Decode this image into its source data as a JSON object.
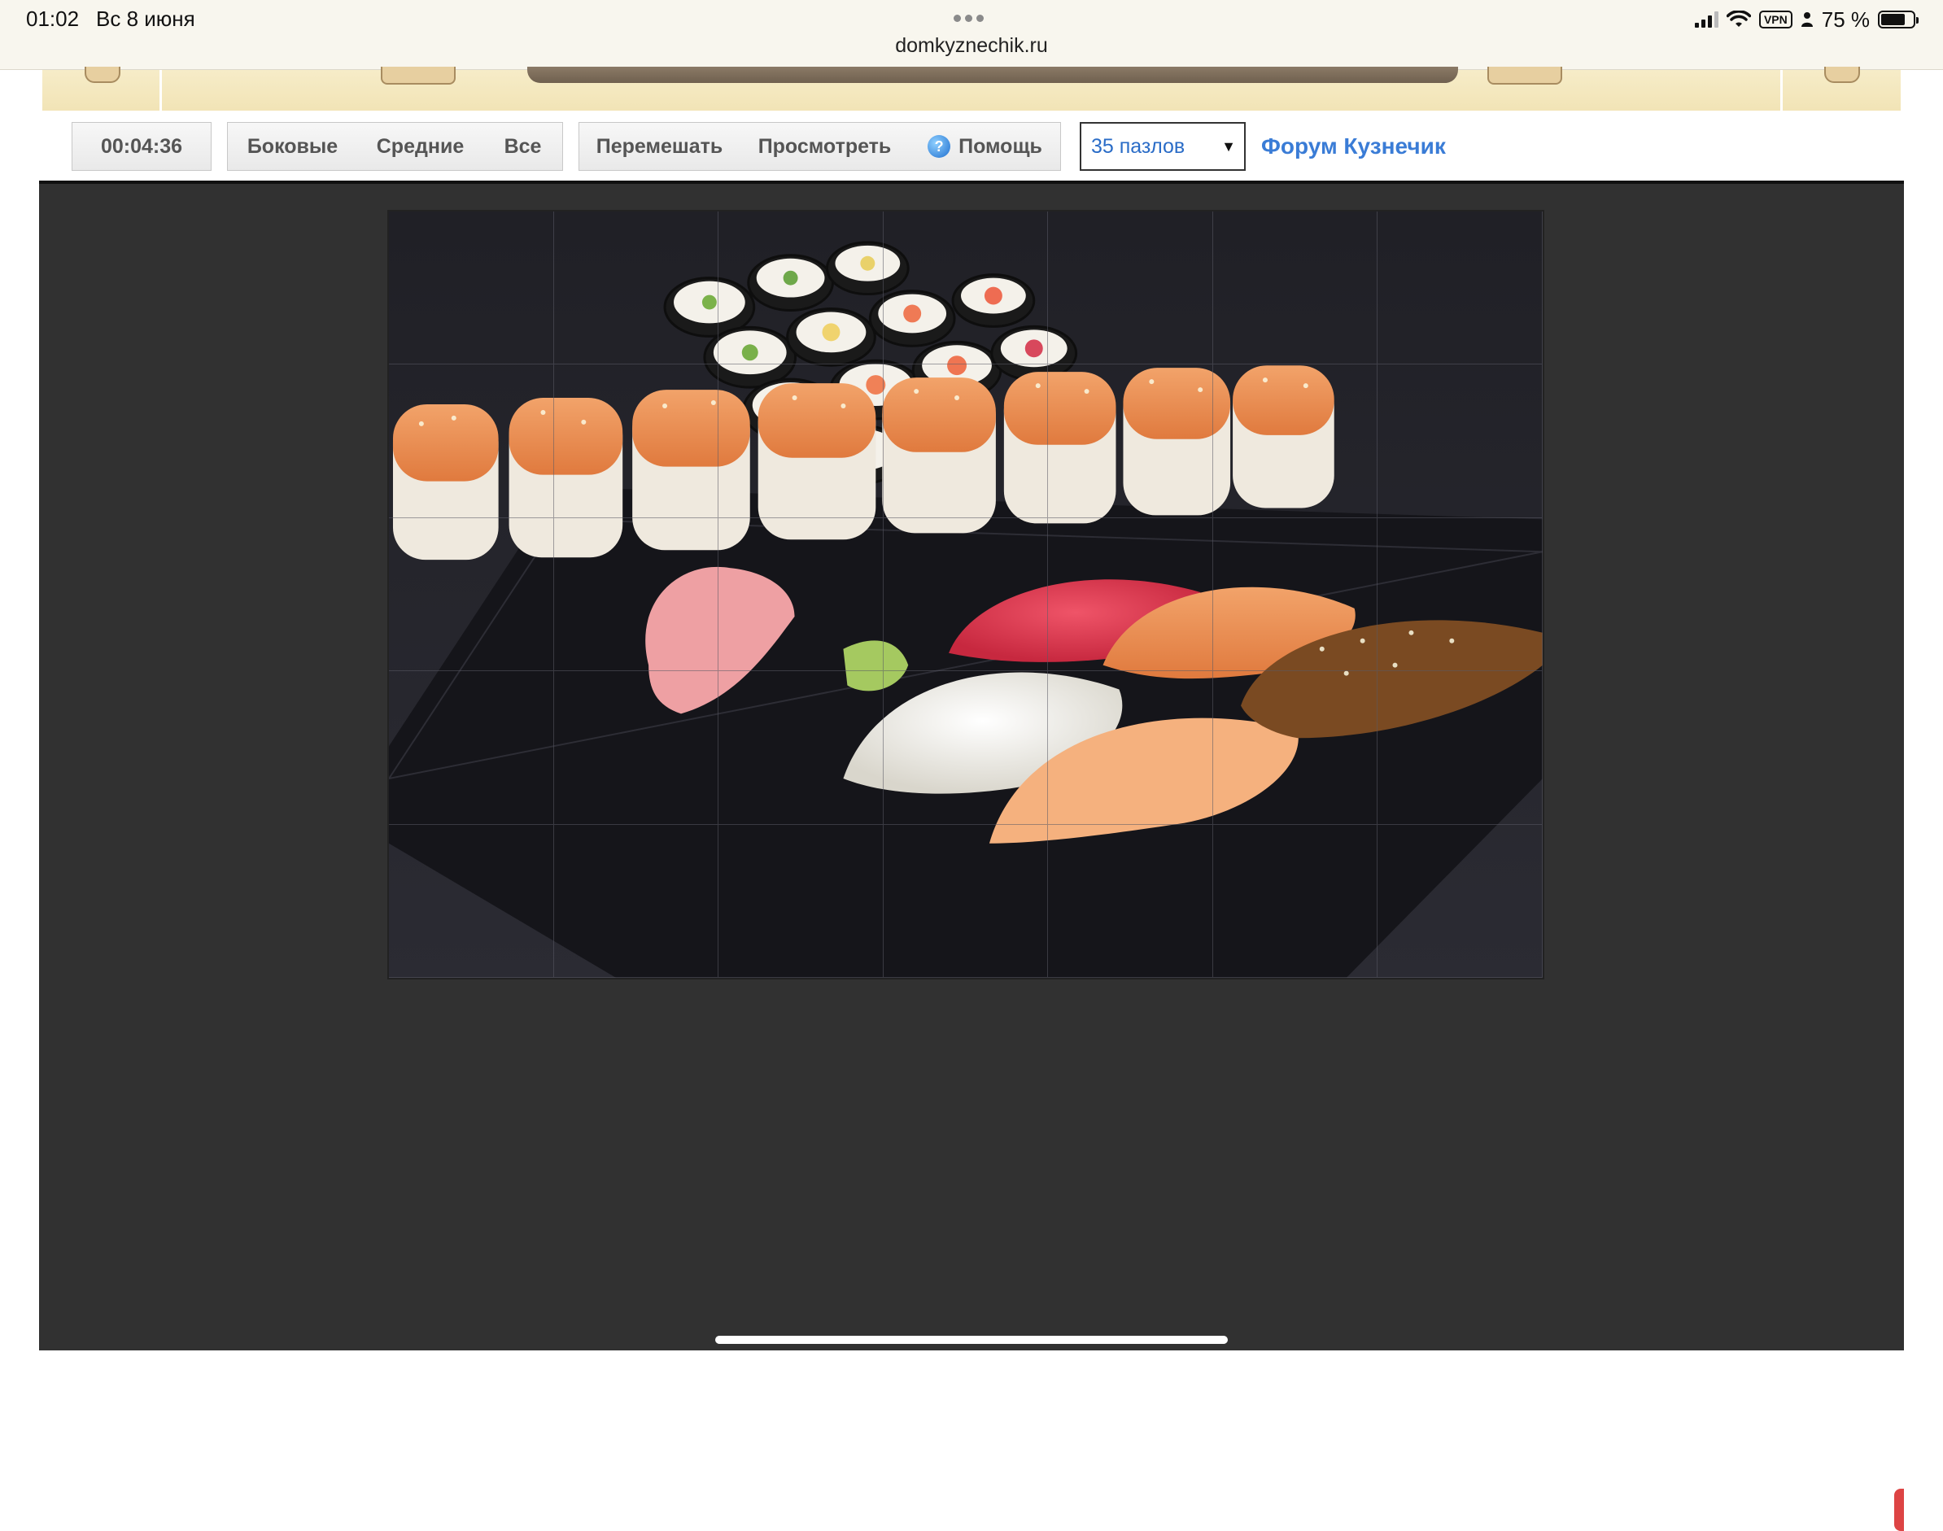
{
  "status_bar": {
    "time": "01:02",
    "date": "Вс 8 июня",
    "url": "domkyznechik.ru",
    "vpn": "VPN",
    "battery": "75 %",
    "battery_level": 0.75
  },
  "toolbar": {
    "timer": "00:04:36",
    "filter_side": "Боковые",
    "filter_middle": "Средние",
    "filter_all": "Все",
    "shuffle": "Перемешать",
    "preview": "Просмотреть",
    "help": "Помощь",
    "pieces_select": "35 пазлов",
    "forum_link": "Форум Кузнечик"
  },
  "puzzle": {
    "columns": 7,
    "rows": 5,
    "image_subject": "sushi-set-photo"
  },
  "colors": {
    "link": "#3a7cd6",
    "game_bg": "#313131",
    "banner": "#f6ecc8"
  }
}
